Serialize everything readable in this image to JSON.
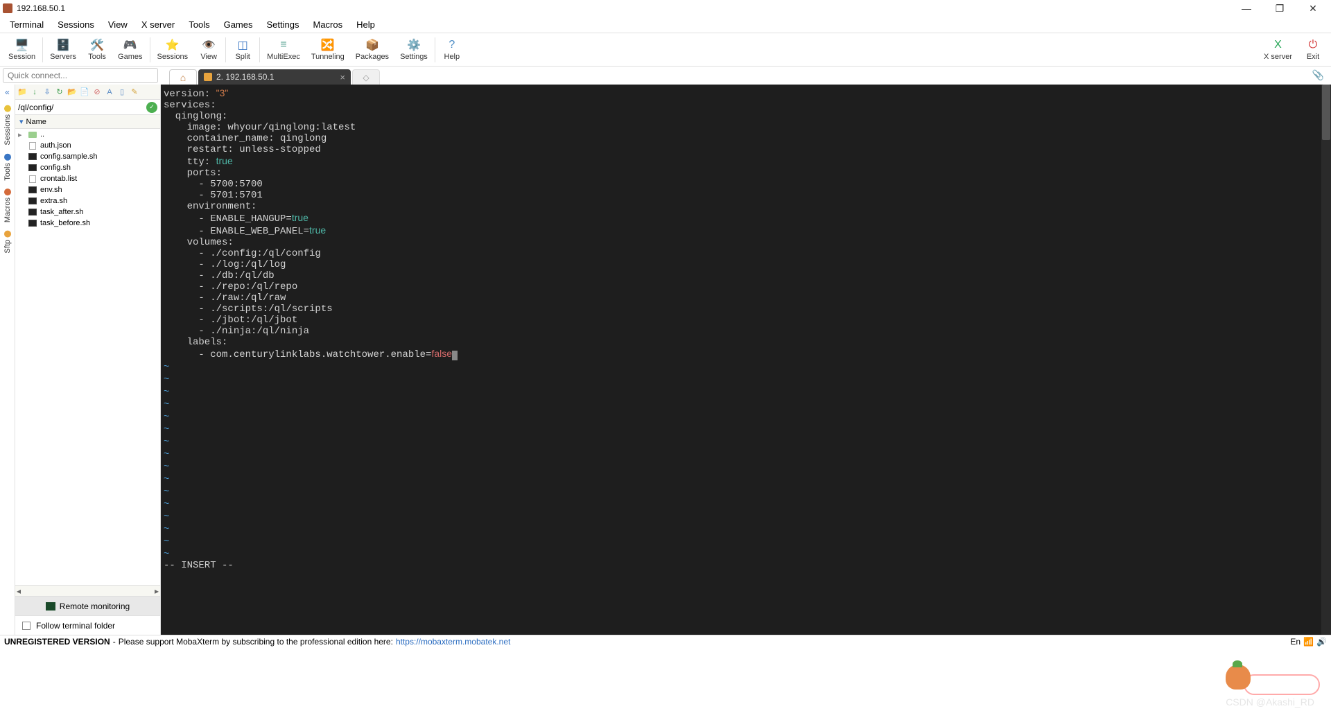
{
  "title": "192.168.50.1",
  "window_controls": {
    "min": "—",
    "max": "❐",
    "close": "✕"
  },
  "menu": [
    "Terminal",
    "Sessions",
    "View",
    "X server",
    "Tools",
    "Games",
    "Settings",
    "Macros",
    "Help"
  ],
  "toolbar": [
    {
      "label": "Session",
      "icon": "🖥️",
      "color": "#3a76c4"
    },
    {
      "label": "Servers",
      "icon": "🗄️",
      "color": "#c43a3a"
    },
    {
      "label": "Tools",
      "icon": "🛠️",
      "color": "#5a8bc4"
    },
    {
      "label": "Games",
      "icon": "🎮",
      "color": "#d4a23a"
    },
    {
      "label": "Sessions",
      "icon": "⭐",
      "color": "#e8c23a"
    },
    {
      "label": "View",
      "icon": "👁️",
      "color": "#4a9b6a"
    },
    {
      "label": "Split",
      "icon": "◫",
      "color": "#3a76c4"
    },
    {
      "label": "MultiExec",
      "icon": "≡",
      "color": "#4a9b8a"
    },
    {
      "label": "Tunneling",
      "icon": "🔀",
      "color": "#a85232"
    },
    {
      "label": "Packages",
      "icon": "📦",
      "color": "#8a6a4a"
    },
    {
      "label": "Settings",
      "icon": "⚙️",
      "color": "#4a7a9b"
    },
    {
      "label": "Help",
      "icon": "?",
      "color": "#4a8bc4"
    }
  ],
  "toolbar_right": [
    {
      "label": "X server",
      "icon": "X",
      "color": "#2aa85a"
    },
    {
      "label": "Exit",
      "icon": "⏻",
      "color": "#d43a3a"
    }
  ],
  "quick_connect_placeholder": "Quick connect...",
  "tabs": {
    "home_icon": "⌂",
    "active": {
      "index": "2.",
      "label": "192.168.50.1"
    },
    "new": "◇"
  },
  "vrail": [
    {
      "label": "Sessions",
      "color": "#e8c23a"
    },
    {
      "label": "Tools",
      "color": "#3a76c4"
    },
    {
      "label": "Macros",
      "color": "#d46a3a"
    },
    {
      "label": "Sftp",
      "color": "#e8a33d"
    }
  ],
  "sidebar": {
    "toolbar_icons": [
      "📁",
      "↓",
      "⇩",
      "↻",
      "📂",
      "📄",
      "⊘",
      "A",
      "▯",
      "✎"
    ],
    "path": "/ql/config/",
    "header": "Name",
    "files": [
      {
        "name": "..",
        "type": "folder"
      },
      {
        "name": "auth.json",
        "type": "file"
      },
      {
        "name": "config.sample.sh",
        "type": "term"
      },
      {
        "name": "config.sh",
        "type": "term"
      },
      {
        "name": "crontab.list",
        "type": "file"
      },
      {
        "name": "env.sh",
        "type": "term"
      },
      {
        "name": "extra.sh",
        "type": "term"
      },
      {
        "name": "task_after.sh",
        "type": "term"
      },
      {
        "name": "task_before.sh",
        "type": "term"
      }
    ],
    "monitor": "Remote monitoring",
    "follow": "Follow terminal folder"
  },
  "terminal": {
    "lines": [
      {
        "t": "version: ",
        "s": "\"3\""
      },
      {
        "t": "services:"
      },
      {
        "t": "  qinglong:"
      },
      {
        "t": "    image: whyour/qinglong:latest"
      },
      {
        "t": "    container_name: qinglong"
      },
      {
        "t": "    restart: unless-stopped"
      },
      {
        "t": "    tty: ",
        "true": "true"
      },
      {
        "t": "    ports:"
      },
      {
        "t": "      - 5700:5700"
      },
      {
        "t": "      - 5701:5701"
      },
      {
        "t": "    environment:"
      },
      {
        "t": "      - ENABLE_HANGUP=",
        "true": "true"
      },
      {
        "t": "      - ENABLE_WEB_PANEL=",
        "true": "true"
      },
      {
        "t": "    volumes:"
      },
      {
        "t": "      - ./config:/ql/config"
      },
      {
        "t": "      - ./log:/ql/log"
      },
      {
        "t": "      - ./db:/ql/db"
      },
      {
        "t": "      - ./repo:/ql/repo"
      },
      {
        "t": "      - ./raw:/ql/raw"
      },
      {
        "t": "      - ./scripts:/ql/scripts"
      },
      {
        "t": "      - ./jbot:/ql/jbot"
      },
      {
        "t": "      - ./ninja:/ql/ninja"
      },
      {
        "t": "    labels:"
      },
      {
        "t": "      - com.centurylinklabs.watchtower.enable=",
        "false": "false",
        "cursor": true
      }
    ],
    "tilde_rows": 16,
    "mode": "-- INSERT --"
  },
  "status": {
    "unreg": "UNREGISTERED VERSION",
    "dash": " - ",
    "text": "Please support MobaXterm by subscribing to the professional edition here: ",
    "url": "https://mobaxterm.mobatek.net",
    "lang": "En"
  },
  "watermark": "CSDN @Akashi_RD"
}
